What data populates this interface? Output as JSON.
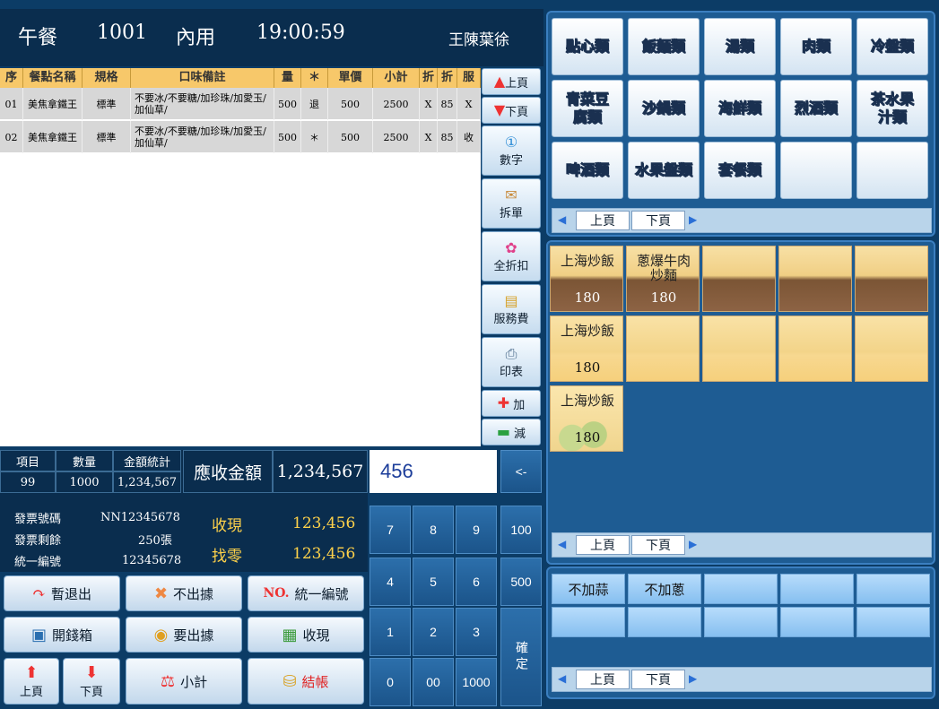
{
  "header": {
    "meal": "午餐",
    "table": "1001",
    "mode": "內用",
    "time": "19:00:59",
    "operator": "王陳葉徐"
  },
  "columns": [
    "序",
    "餐點名稱",
    "規格",
    "口味備註",
    "量",
    "＊",
    "單價",
    "小計",
    "折",
    "折",
    "服"
  ],
  "rows": [
    [
      "01",
      "美焦拿鐵王",
      "標準",
      "不要冰/不要糖/加珍珠/加愛玉/加仙草/",
      "500",
      "退",
      "500",
      "2500",
      "X",
      "85",
      "X"
    ],
    [
      "02",
      "美焦拿鐵王",
      "標準",
      "不要冰/不要糖/加珍珠/加愛玉/加仙草/",
      "500",
      "＊",
      "500",
      "2500",
      "X",
      "85",
      "收"
    ]
  ],
  "side": {
    "up": "上頁",
    "down": "下頁",
    "number": "數字",
    "split": "拆單",
    "discount": "全折扣",
    "service": "服務費",
    "print": "印表",
    "add": "加",
    "minus": "減"
  },
  "stats": {
    "items_label": "項目",
    "qty_label": "數量",
    "total_label": "金額統計",
    "items": "99",
    "qty": "1000",
    "total": "1,234,567",
    "due_label": "應收金額",
    "due": "1,234,567",
    "inv_no_label": "發票號碼",
    "inv_no": "NN12345678",
    "inv_left_label": "發票剩餘",
    "inv_left": "250張",
    "tax_label": "統一編號",
    "tax": "12345678",
    "cash_label": "收現",
    "cash": "123,456",
    "change_label": "找零",
    "change": "123,456"
  },
  "buttons": {
    "exit": "暫退出",
    "no_receipt": "不出據",
    "no_prefix": "NO.",
    "tax_id": "統一編號",
    "drawer": "開錢箱",
    "receipt": "要出據",
    "cash": "收現",
    "up": "上頁",
    "down": "下頁",
    "subtotal": "小計",
    "checkout": "結帳"
  },
  "numpad": {
    "display": "456",
    "back": "<-",
    "keys": [
      "7",
      "8",
      "9",
      "100",
      "4",
      "5",
      "6",
      "500",
      "1",
      "2",
      "3",
      "0",
      "00",
      "1000"
    ],
    "confirm": "確定"
  },
  "categories": [
    "點心類",
    "飯麵類",
    "湯類",
    "肉類",
    "冷盤類",
    "青菜豆腐類",
    "沙鍋類",
    "海鮮類",
    "烈酒類",
    "茶水果汁類",
    "啤酒類",
    "水果盤類",
    "套餐類",
    "",
    ""
  ],
  "pager": {
    "prev": "上頁",
    "next": "下頁"
  },
  "foods": [
    {
      "name": "上海炒飯",
      "price": "180",
      "style": "a"
    },
    {
      "name": "蔥爆牛肉炒麵",
      "price": "180",
      "style": "a"
    },
    {
      "name": "",
      "price": "",
      "style": "a"
    },
    {
      "name": "",
      "price": "",
      "style": "a"
    },
    {
      "name": "",
      "price": "",
      "style": "a"
    },
    {
      "name": "上海炒飯",
      "price": "180",
      "style": "b"
    },
    {
      "name": "",
      "price": "",
      "style": "b"
    },
    {
      "name": "",
      "price": "",
      "style": "b"
    },
    {
      "name": "",
      "price": "",
      "style": "b"
    },
    {
      "name": "",
      "price": "",
      "style": "b"
    },
    {
      "name": "上海炒飯",
      "price": "180",
      "style": "c"
    }
  ],
  "options": [
    "不加蒜",
    "不加蔥",
    "",
    "",
    "",
    "",
    "",
    "",
    "",
    ""
  ]
}
